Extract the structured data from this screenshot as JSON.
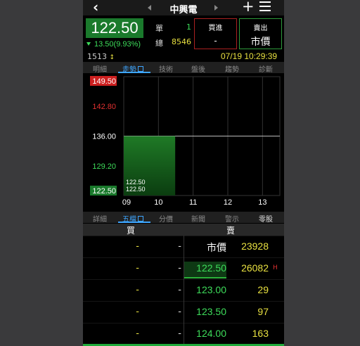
{
  "header": {
    "stock_name": "中興電"
  },
  "quote": {
    "price": "122.50",
    "change": "13.50(9.93%)",
    "single_label": "單",
    "single_value": "1",
    "total_label": "總",
    "total_value": "8546",
    "buy_title": "買進",
    "buy_value": "-",
    "sell_title": "賣出",
    "sell_value": "市價",
    "volume": "1513",
    "datetime": "07/19 10:29:39"
  },
  "tabs_top": [
    "明細",
    "走勢",
    "技術",
    "盤後",
    "趨勢",
    "診斷"
  ],
  "tabs_bottom": [
    "詳細",
    "五檔",
    "分價",
    "新聞",
    "警示",
    "零股"
  ],
  "colors": {
    "up": "#ff3030",
    "down": "#3ddc5a",
    "accent": "#3ea6ff",
    "yellow": "#e8e040"
  },
  "chart_data": {
    "type": "area",
    "y_ticks": [
      "149.50",
      "142.80",
      "136.00",
      "129.20",
      "122.50"
    ],
    "x_ticks": [
      "09",
      "10",
      "11",
      "12",
      "13"
    ],
    "ylim": [
      122.5,
      149.5
    ],
    "reference_price": 136.0,
    "series": [
      {
        "x": [
          "09:00",
          "10:29"
        ],
        "values": [
          122.5,
          122.5
        ]
      }
    ],
    "inline_labels": [
      "122.50",
      "122.50"
    ]
  },
  "order_book": {
    "buy_header": "買",
    "sell_header": "賣",
    "rows": [
      {
        "bid_qty": "-",
        "bid_price": "-",
        "ask_price": "市價",
        "ask_qty": "23928",
        "mark": ""
      },
      {
        "bid_qty": "-",
        "bid_price": "-",
        "ask_price": "122.50",
        "ask_qty": "26082",
        "mark": "H"
      },
      {
        "bid_qty": "-",
        "bid_price": "-",
        "ask_price": "123.00",
        "ask_qty": "29",
        "mark": ""
      },
      {
        "bid_qty": "-",
        "bid_price": "-",
        "ask_price": "123.50",
        "ask_qty": "97",
        "mark": ""
      },
      {
        "bid_qty": "-",
        "bid_price": "-",
        "ask_price": "124.00",
        "ask_qty": "163",
        "mark": ""
      }
    ]
  }
}
